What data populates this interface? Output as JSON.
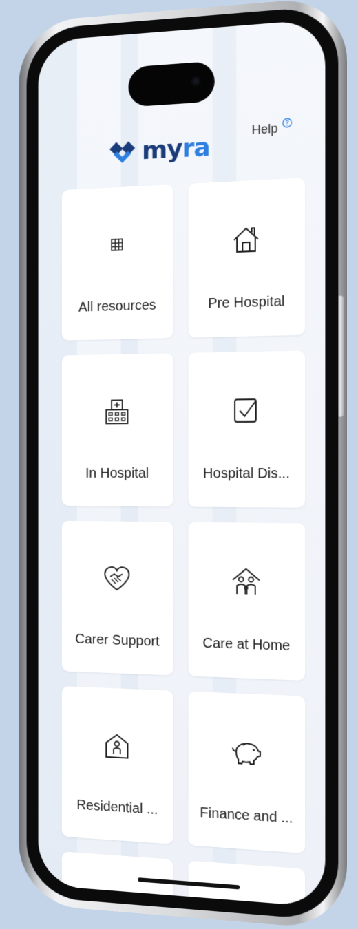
{
  "app": {
    "name": "myra"
  },
  "brand": {
    "colors": {
      "dark": "#1b3c7a",
      "accent": "#2f7fe0"
    }
  },
  "logo": {
    "text_part1": "my",
    "text_part2": "ra"
  },
  "header": {
    "help_label": "Help",
    "help_icon": "question-circle-icon"
  },
  "tiles": [
    {
      "label": "All resources",
      "icon": "grid-icon"
    },
    {
      "label": "Pre Hospital",
      "icon": "house-icon"
    },
    {
      "label": "In Hospital",
      "icon": "hospital-building-icon"
    },
    {
      "label": "Hospital Dis...",
      "icon": "checkbox-icon"
    },
    {
      "label": "Carer Support",
      "icon": "heart-handshake-icon"
    },
    {
      "label": "Care at Home",
      "icon": "family-home-icon"
    },
    {
      "label": "Residential ...",
      "icon": "person-house-icon"
    },
    {
      "label": "Finance and ...",
      "icon": "piggy-bank-icon"
    }
  ]
}
